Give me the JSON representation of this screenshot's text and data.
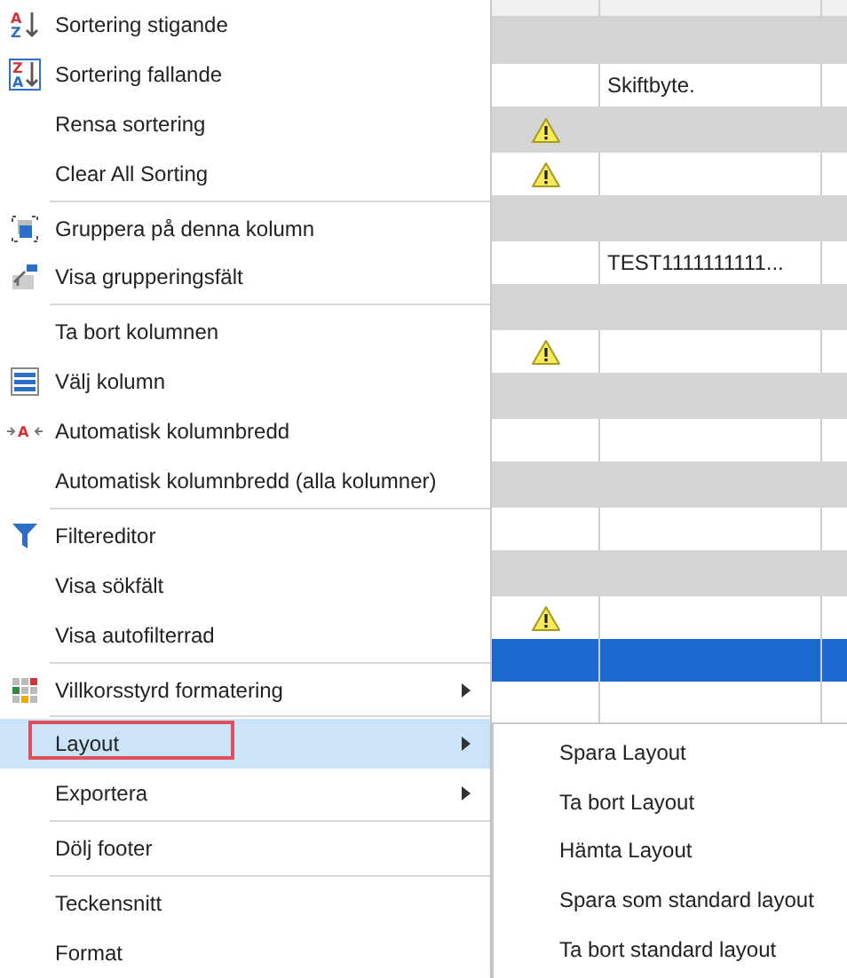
{
  "menu": {
    "groups": [
      [
        {
          "label": "Sortering stigande",
          "kind": "sort-ascending",
          "icon_letters": [
            "A",
            "Z"
          ],
          "has_submenu": false,
          "selected": false,
          "outlined": false
        },
        {
          "label": "Sortering fallande",
          "kind": "sort-descending",
          "icon_letters": [
            "Z",
            "A"
          ],
          "has_submenu": false,
          "selected": false,
          "outlined": false
        },
        {
          "label": "Rensa sortering",
          "kind": "plain",
          "has_submenu": false,
          "selected": false,
          "outlined": false
        },
        {
          "label": "Clear All Sorting",
          "kind": "plain",
          "has_submenu": false,
          "selected": false,
          "outlined": false
        }
      ],
      [
        {
          "label": "Gruppera på denna kolumn",
          "kind": "group",
          "has_submenu": false,
          "selected": false,
          "outlined": false
        },
        {
          "label": "Visa grupperingsfält",
          "kind": "group-panel",
          "has_submenu": false,
          "selected": false,
          "outlined": false
        }
      ],
      [
        {
          "label": "Ta bort kolumnen",
          "kind": "plain",
          "has_submenu": false,
          "selected": false,
          "outlined": false
        },
        {
          "label": "Välj kolumn",
          "kind": "column-chooser",
          "has_submenu": false,
          "selected": false,
          "outlined": false
        },
        {
          "label": "Automatisk kolumnbredd",
          "kind": "best-fit",
          "icon_letters": [
            "A"
          ],
          "has_submenu": false,
          "selected": false,
          "outlined": false
        },
        {
          "label": "Automatisk kolumnbredd (alla kolumner)",
          "kind": "plain",
          "has_submenu": false,
          "selected": false,
          "outlined": false
        }
      ],
      [
        {
          "label": "Filtereditor",
          "kind": "filter",
          "has_submenu": false,
          "selected": false,
          "outlined": false
        },
        {
          "label": "Visa sökfält",
          "kind": "plain",
          "has_submenu": false,
          "selected": false,
          "outlined": false
        },
        {
          "label": "Visa autofilterrad",
          "kind": "plain",
          "has_submenu": false,
          "selected": false,
          "outlined": false
        }
      ],
      [
        {
          "label": "Villkorsstyrd formatering",
          "kind": "conditional-format",
          "has_submenu": true,
          "selected": false,
          "outlined": false
        }
      ],
      [
        {
          "label": "Layout",
          "kind": "plain",
          "has_submenu": true,
          "selected": true,
          "outlined": true
        },
        {
          "label": "Exportera",
          "kind": "plain",
          "has_submenu": true,
          "selected": false,
          "outlined": false
        }
      ],
      [
        {
          "label": "Dölj footer",
          "kind": "plain",
          "has_submenu": false,
          "selected": false,
          "outlined": false
        }
      ],
      [
        {
          "label": "Teckensnitt",
          "kind": "plain",
          "has_submenu": false,
          "selected": false,
          "outlined": false
        },
        {
          "label": "Format",
          "kind": "plain",
          "has_submenu": false,
          "selected": false,
          "outlined": false
        }
      ]
    ]
  },
  "submenu": {
    "items": [
      {
        "label": "Spara Layout"
      },
      {
        "label": "Ta bort Layout"
      },
      {
        "label": "Hämta Layout"
      },
      {
        "label": "Spara som standard layout"
      },
      {
        "label": "Ta bort standard layout"
      }
    ]
  },
  "grid": {
    "rows": [
      {
        "kind": "group",
        "warning": false,
        "text": "",
        "selected": false
      },
      {
        "kind": "data",
        "warning": false,
        "text": "Skiftbyte.",
        "selected": false
      },
      {
        "kind": "group",
        "warning": true,
        "text": "",
        "selected": false
      },
      {
        "kind": "data",
        "warning": true,
        "text": "",
        "selected": false
      },
      {
        "kind": "group",
        "warning": false,
        "text": "",
        "selected": false
      },
      {
        "kind": "data",
        "warning": false,
        "text": "TEST1111111111...",
        "selected": false
      },
      {
        "kind": "group",
        "warning": false,
        "text": "",
        "selected": false
      },
      {
        "kind": "data",
        "warning": true,
        "text": "",
        "selected": false
      },
      {
        "kind": "group",
        "warning": false,
        "text": "",
        "selected": false
      },
      {
        "kind": "data",
        "warning": false,
        "text": "",
        "selected": false
      },
      {
        "kind": "group",
        "warning": false,
        "text": "",
        "selected": false
      },
      {
        "kind": "data",
        "warning": false,
        "text": "",
        "selected": false
      },
      {
        "kind": "group",
        "warning": false,
        "text": "",
        "selected": false
      },
      {
        "kind": "data",
        "warning": true,
        "text": "",
        "selected": false
      },
      {
        "kind": "data",
        "warning": false,
        "text": "",
        "selected": true
      },
      {
        "kind": "data",
        "warning": false,
        "text": "",
        "selected": false
      }
    ]
  }
}
